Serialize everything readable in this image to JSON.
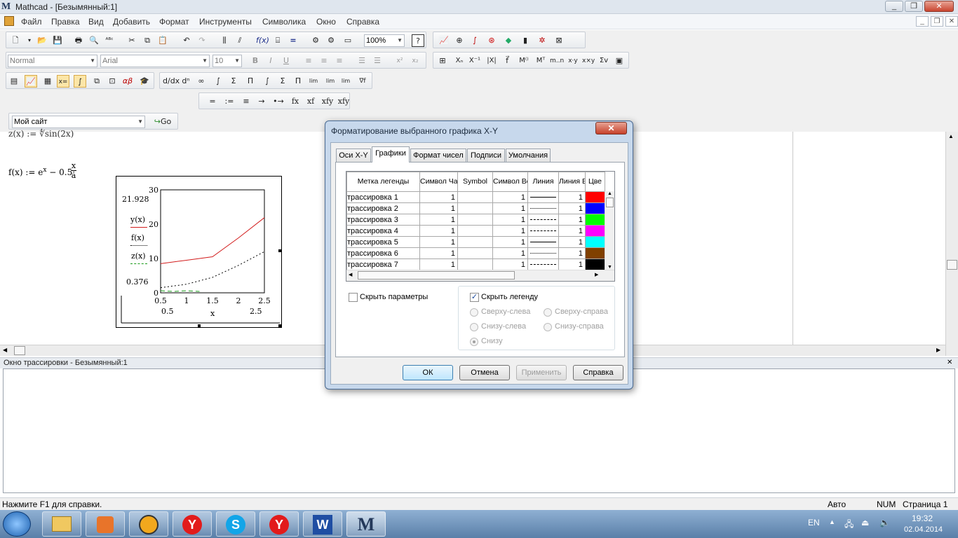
{
  "app": {
    "title": "Mathcad - [Безымянный:1]",
    "logo_letter": "M",
    "window_buttons": [
      "_",
      "❐",
      "✕"
    ]
  },
  "menu": [
    "Файл",
    "Правка",
    "Вид",
    "Добавить",
    "Формат",
    "Инструменты",
    "Символика",
    "Окно",
    "Справка"
  ],
  "toolbar": {
    "zoom": "100%",
    "style": "Normal",
    "font": "Arial",
    "font_size": "10",
    "bold": "B",
    "italic": "I",
    "underline": "U",
    "url_combo": "Мой сайт",
    "go_label": "Go",
    "eval_ops": [
      "=",
      ":=",
      "≡",
      "→",
      "•→",
      "fx",
      "xf",
      "xfy",
      "xfy"
    ]
  },
  "worksheet": {
    "line1": "z(x) := ∜sin(2x)",
    "f_def_left": "f(x) := e",
    "f_def_exp": "x",
    "f_def_mid": " − 0.5·",
    "f_def_num": "x",
    "f_def_den": "a"
  },
  "plot": {
    "y_labels": [
      "30",
      "20",
      "10",
      "0"
    ],
    "x_labels": [
      "0.5",
      "1",
      "1.5",
      "2",
      "2.5"
    ],
    "y_max_marker": "21.928",
    "y_min_marker": "0.376",
    "x_min_marker": "0.5",
    "x_max_marker": "2.5",
    "x_axis_label": "x",
    "legend": [
      "y(x)",
      "f(x)",
      "z(x)"
    ],
    "colors": {
      "y": "#d21c1c",
      "f": "#000000",
      "z": "#1a9a1a"
    }
  },
  "chart_data": {
    "type": "line",
    "xlim": [
      0.5,
      2.5
    ],
    "ylim": [
      0,
      30
    ],
    "series": [
      {
        "name": "y(x)",
        "x": [
          0.5,
          1.0,
          1.5,
          2.0,
          2.5
        ],
        "y": [
          8.5,
          9.5,
          10.5,
          16.0,
          21.9
        ]
      },
      {
        "name": "f(x)",
        "x": [
          0.5,
          1.0,
          1.5,
          2.0,
          2.5
        ],
        "y": [
          1.5,
          2.5,
          4.5,
          8.0,
          12.0
        ]
      },
      {
        "name": "z(x)",
        "x": [
          0.5,
          0.75,
          1.0,
          1.25
        ],
        "y": [
          0.6,
          0.4,
          0.6,
          0.4
        ]
      }
    ],
    "grid": false
  },
  "dialog": {
    "title": "Форматирование выбранного графика X-Y",
    "close": "✕",
    "tabs": [
      "Оси X-Y",
      "Графики",
      "Формат чисел",
      "Подписи",
      "Умолчания"
    ],
    "active_tab": "Графики",
    "columns": [
      "Метка легенды",
      "Символ Частота",
      "Symbol",
      "Символ Вес",
      "Линия",
      "Линия Вес",
      "Цве"
    ],
    "rows": [
      {
        "label": "трассировка 1",
        "freq": "1",
        "symbol": "",
        "weight": "1",
        "line": "solid",
        "lw": "1",
        "color": "#ff0000"
      },
      {
        "label": "трассировка 2",
        "freq": "1",
        "symbol": "",
        "weight": "1",
        "line": "dotted",
        "lw": "1",
        "color": "#0000ff"
      },
      {
        "label": "трассировка 3",
        "freq": "1",
        "symbol": "",
        "weight": "1",
        "line": "dashed",
        "lw": "1",
        "color": "#00ff00"
      },
      {
        "label": "трассировка 4",
        "freq": "1",
        "symbol": "",
        "weight": "1",
        "line": "dashdot",
        "lw": "1",
        "color": "#ff00ff"
      },
      {
        "label": "трассировка 5",
        "freq": "1",
        "symbol": "",
        "weight": "1",
        "line": "solid",
        "lw": "1",
        "color": "#00ffff"
      },
      {
        "label": "трассировка 6",
        "freq": "1",
        "symbol": "",
        "weight": "1",
        "line": "dotted",
        "lw": "1",
        "color": "#804000"
      },
      {
        "label": "трассировка 7",
        "freq": "1",
        "symbol": "",
        "weight": "1",
        "line": "dashed",
        "lw": "1",
        "color": "#000000"
      }
    ],
    "hide_params": "Скрыть параметры",
    "hide_legend": "Скрыть легенду",
    "legend_positions": [
      "Сверху-слева",
      "Сверху-справа",
      "Снизу-слева",
      "Снизу-справа",
      "Снизу"
    ],
    "buttons": {
      "ok": "ОК",
      "cancel": "Отмена",
      "apply": "Применить",
      "help": "Справка"
    }
  },
  "trace_window": {
    "title": "Окно трассировки - Безымянный:1"
  },
  "status": {
    "help": "Нажмите F1 для справки.",
    "auto": "Авто",
    "num": "NUM",
    "page": "Страница 1"
  },
  "taskbar": {
    "lang": "EN",
    "time": "19:32",
    "date": "02.04.2014"
  }
}
